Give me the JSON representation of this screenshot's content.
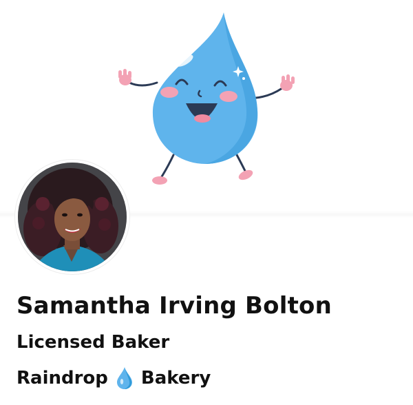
{
  "profile": {
    "name": "Samantha Irving Bolton",
    "title": "Licensed Baker",
    "company_first": "Raindrop",
    "company_icon": "droplet-icon",
    "company_second": "Bakery"
  },
  "colors": {
    "drop_blue": "#5fb4ec",
    "drop_dark": "#2f9ad8",
    "cheek_pink": "#f3a2b4",
    "outline": "#2b3a55"
  }
}
